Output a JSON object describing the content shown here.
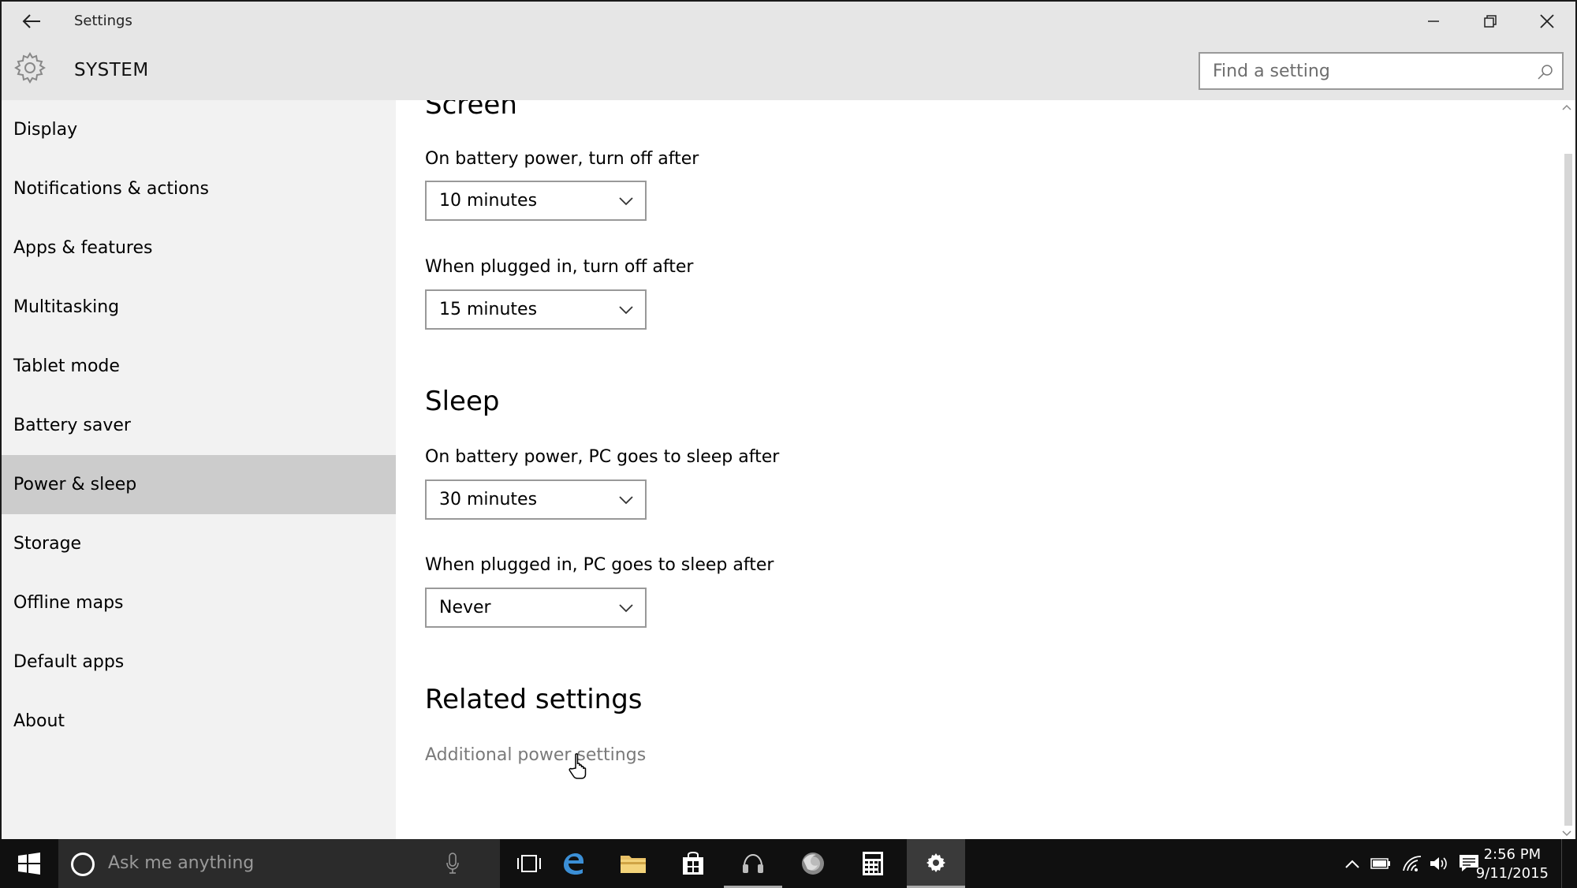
{
  "window": {
    "title": "Settings"
  },
  "header": {
    "section": "SYSTEM",
    "search_placeholder": "Find a setting"
  },
  "sidebar": {
    "items": [
      {
        "label": "Display"
      },
      {
        "label": "Notifications & actions"
      },
      {
        "label": "Apps & features"
      },
      {
        "label": "Multitasking"
      },
      {
        "label": "Tablet mode"
      },
      {
        "label": "Battery saver"
      },
      {
        "label": "Power & sleep"
      },
      {
        "label": "Storage"
      },
      {
        "label": "Offline maps"
      },
      {
        "label": "Default apps"
      },
      {
        "label": "About"
      }
    ],
    "active_index": 6
  },
  "content": {
    "screen": {
      "title": "Screen",
      "battery_label": "On battery power, turn off after",
      "battery_value": "10 minutes",
      "plugged_label": "When plugged in, turn off after",
      "plugged_value": "15 minutes"
    },
    "sleep": {
      "title": "Sleep",
      "battery_label": "On battery power, PC goes to sleep after",
      "battery_value": "30 minutes",
      "plugged_label": "When plugged in, PC goes to sleep after",
      "plugged_value": "Never"
    },
    "related": {
      "title": "Related settings",
      "link": "Additional power settings"
    }
  },
  "taskbar": {
    "cortana_placeholder": "Ask me anything",
    "time": "2:56 PM",
    "date": "9/11/2015"
  },
  "colors": {
    "header_bg": "#e6e6e6",
    "sidebar_bg": "#f2f2f2",
    "active_item_bg": "#cccccc",
    "taskbar_bg": "#101010",
    "link_color": "#7a7a7a"
  }
}
